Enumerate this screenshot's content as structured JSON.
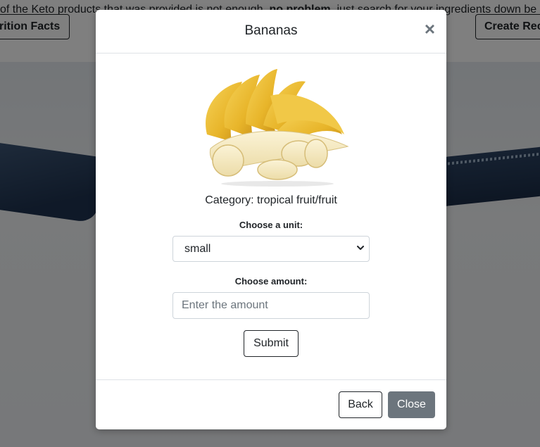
{
  "background": {
    "intro_text_start": "of the Keto products that was provided is not enough, ",
    "intro_text_bold": "no problem",
    "intro_text_end": ", just search for your ingredients down be",
    "left_button_label": "rition Facts",
    "right_button_label": "Create Rec"
  },
  "modal": {
    "title": "Bananas",
    "close_symbol": "×",
    "image_icon": "banana-photo",
    "category": "Category: tropical fruit/fruit",
    "unit_label": "Choose a unit:",
    "unit_selected": "small",
    "amount_label": "Choose amount:",
    "amount_value": "",
    "amount_placeholder": "Enter the amount",
    "submit_label": "Submit",
    "back_label": "Back",
    "close_label": "Close"
  },
  "colors": {
    "close_button_bg": "#6c757d",
    "backdrop": "rgba(0,0,0,0.5)"
  }
}
